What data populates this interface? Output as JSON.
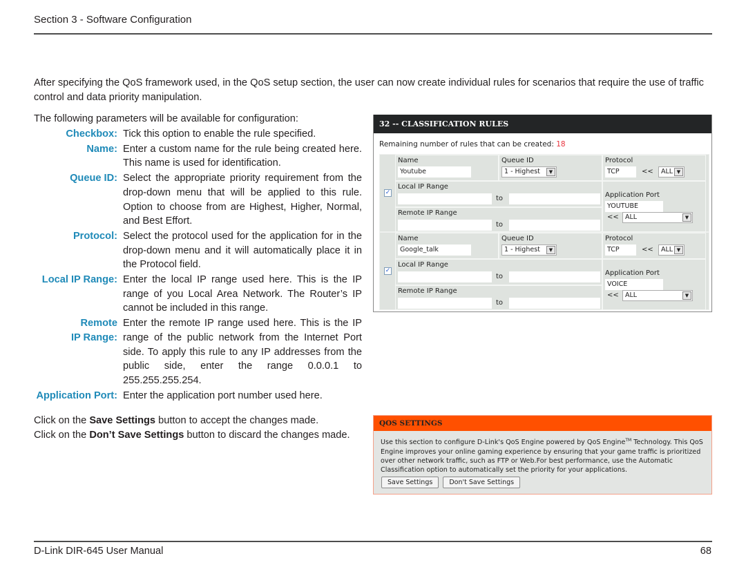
{
  "header": {
    "section": "Section 3 - Software Configuration"
  },
  "intro": "After specifying the QoS framework used, in the QoS setup section, the user can now create individual rules for scenarios that require the use of traffic control and data priority manipulation.",
  "following": "The following parameters will be available for configuration:",
  "params": [
    {
      "label": "Checkbox:",
      "desc": "Tick this option to enable the rule specified."
    },
    {
      "label": "Name:",
      "desc": "Enter a custom name for the rule being created here. This name is used for identification."
    },
    {
      "label": "Queue ID:",
      "desc": "Select the appropriate priority requirement from the drop-down menu that will be applied to this rule. Option to choose from are Highest, Higher, Normal, and Best Effort."
    },
    {
      "label": "Protocol:",
      "desc": "Select the protocol used for the application for in the drop-down menu and it will automatically place it in the Protocol field."
    },
    {
      "label": "Local IP Range:",
      "desc": "Enter the local IP range used here. This is the IP range of you Local Area Network. The Router’s IP cannot be included in this range."
    },
    {
      "label": "Remote IP Range:",
      "desc": "Enter the remote IP range used here. This is the IP range of the public network from the Internet Port side. To apply this rule to any IP addresses from the public side, enter the range 0.0.0.1 to 255.255.255.254."
    },
    {
      "label": "Application Port:",
      "desc": "Enter the application port number used here."
    }
  ],
  "save_note": {
    "line1_pre": "Click on the ",
    "line1_bold": "Save Settings",
    "line1_post": " button to accept the changes made.",
    "line2_pre": "Click on the ",
    "line2_bold": "Don’t Save Settings",
    "line2_post": " button to discard the changes made."
  },
  "classification": {
    "title": "32 -- CLASSIFICATION RULES",
    "remaining_label": "Remaining number of rules that can be created: ",
    "remaining_count": "18",
    "labels": {
      "name": "Name",
      "queue_id": "Queue ID",
      "protocol": "Protocol",
      "local_ip": "Local IP Range",
      "remote_ip": "Remote IP Range",
      "app_port": "Application Port",
      "to": "to",
      "arrows": "<<"
    },
    "rules": [
      {
        "checked": true,
        "name": "Youtube",
        "queue_id": "1 - Highest",
        "protocol": "TCP",
        "protocol_select": "ALL",
        "local_from": "",
        "local_to": "",
        "remote_from": "",
        "remote_to": "",
        "app_port": "YOUTUBE",
        "app_port_select": "ALL"
      },
      {
        "checked": true,
        "name": "Google_talk",
        "queue_id": "1 - Highest",
        "protocol": "TCP",
        "protocol_select": "ALL",
        "local_from": "",
        "local_to": "",
        "remote_from": "",
        "remote_to": "",
        "app_port": "VOICE",
        "app_port_select": "ALL"
      }
    ]
  },
  "qos": {
    "title": "QOS SETTINGS",
    "desc_pre": "Use this section to configure D-Link's QoS Engine powered by QoS Engine",
    "desc_tm": "TM",
    "desc_post": " Technology. This QoS Engine improves your online gaming experience by ensuring that your game traffic is prioritized over other network traffic, such as FTP or Web.For best performance, use the Automatic Classification option to automatically set the priority for your applications.",
    "save_button": "Save Settings",
    "dont_save_button": "Don't Save Settings"
  },
  "footer": {
    "manual": "D-Link DIR-645 User Manual",
    "page": "68"
  }
}
